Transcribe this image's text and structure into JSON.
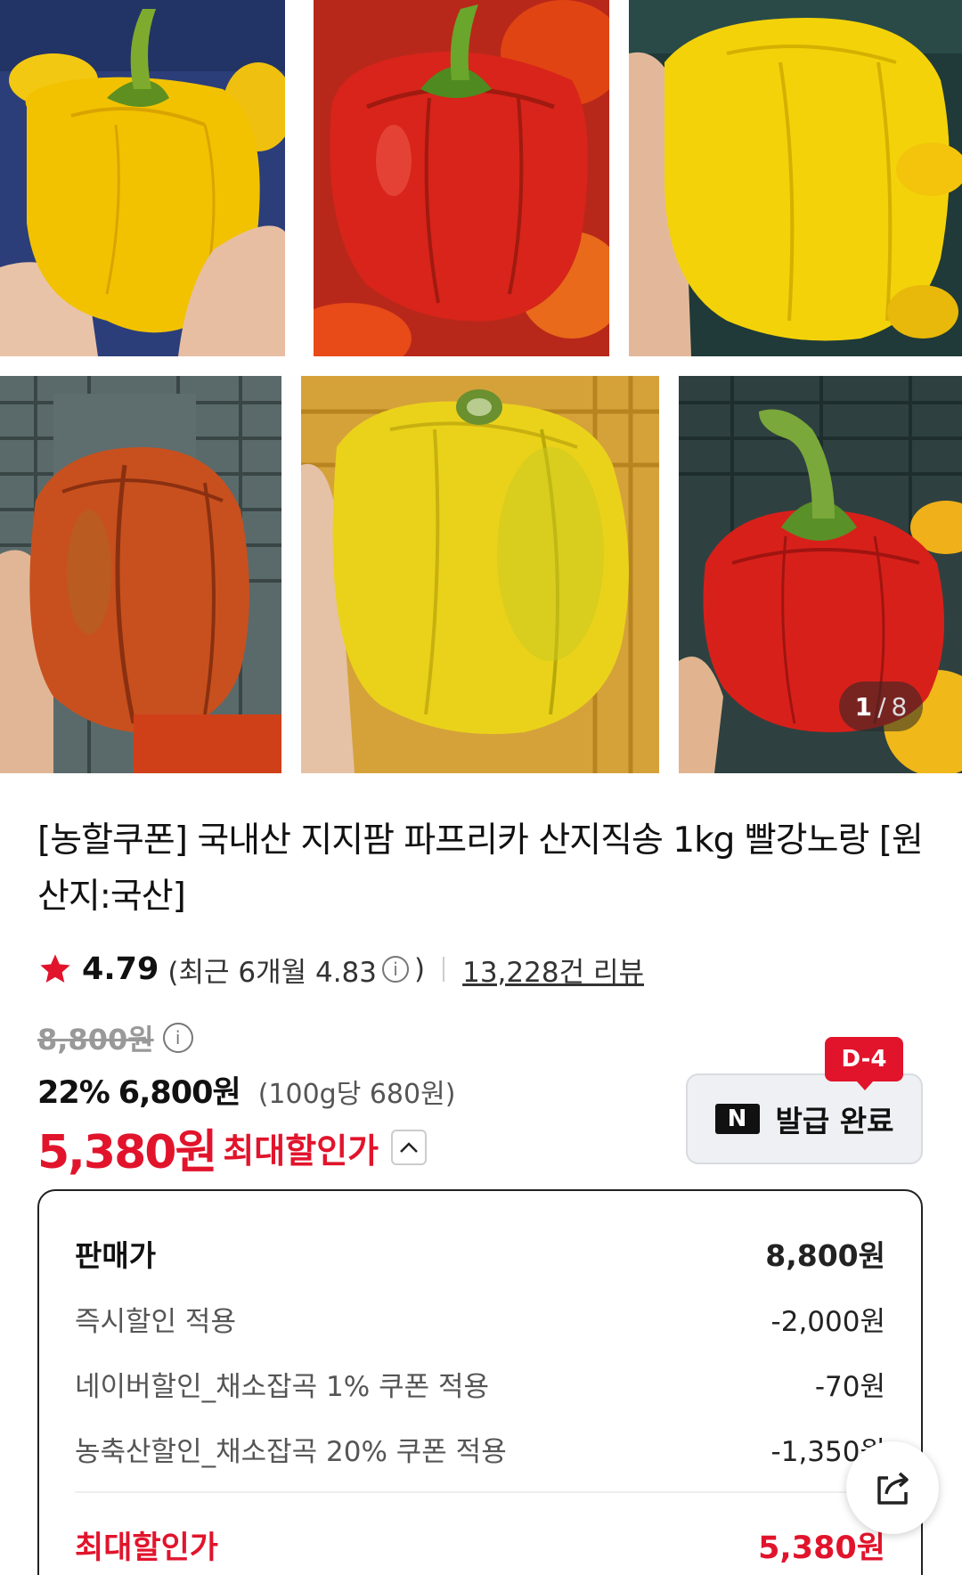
{
  "gallery": {
    "current": "1",
    "separator": "/",
    "total": "8"
  },
  "product": {
    "title": "[농할쿠폰] 국내산 지지팜 파프리카 산지직송 1kg 빨강노랑 [원산지:국산]",
    "rating": "4.79",
    "recent_rating_prefix": "(최근 6개월 4.83",
    "recent_rating_suffix": ")",
    "review_count": "13,228건 리뷰"
  },
  "price": {
    "original": "8,800원",
    "discount_pct": "22%",
    "sale_price": "6,800원",
    "unit_price": "(100g당 680원)",
    "max_price": "5,380원",
    "max_label": "최대할인가"
  },
  "coupon": {
    "badge": "D-4",
    "logo": "N",
    "status": "발급 완료"
  },
  "breakdown": {
    "rows": [
      {
        "label": "판매가",
        "value": "8,800원"
      },
      {
        "label": "즉시할인 적용",
        "value": "-2,000원"
      },
      {
        "label": "네이버할인_채소잡곡 1% 쿠폰 적용",
        "value": "-70원"
      },
      {
        "label": "농축산할인_채소잡곡 20% 쿠폰 적용",
        "value": "-1,350원"
      }
    ],
    "total_label": "최대할인가",
    "total_value": "5,380원"
  },
  "colors": {
    "accent": "#e1142c",
    "yellow_pepper": "#f2c200",
    "red_pepper": "#d0211a"
  },
  "icons": {
    "rating": "star-icon",
    "info": "info-icon",
    "collapse": "chevron-up-icon",
    "share": "share-icon"
  }
}
